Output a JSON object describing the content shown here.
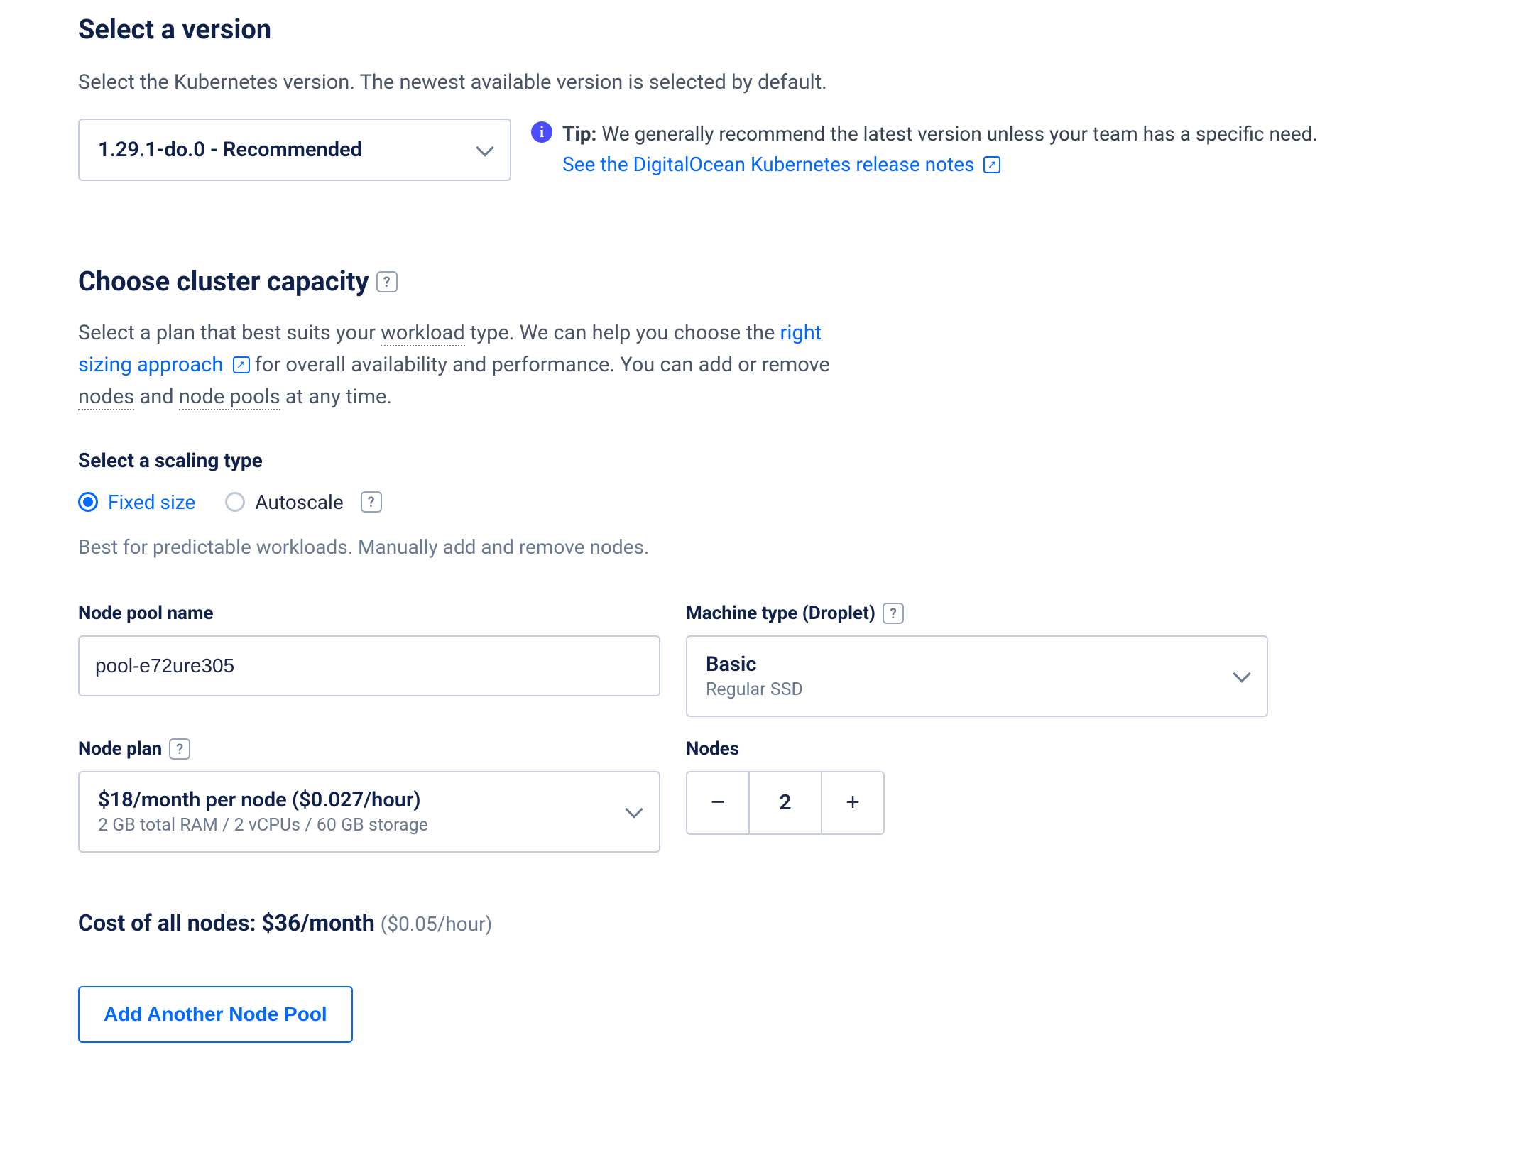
{
  "version": {
    "heading": "Select a version",
    "description": "Select the Kubernetes version. The newest available version is selected by default.",
    "selected": "1.29.1-do.0 - Recommended",
    "tip_label": "Tip:",
    "tip_text": "We generally recommend the latest version unless your team has a specific need.",
    "tip_link": "See the DigitalOcean Kubernetes release notes"
  },
  "capacity": {
    "heading": "Choose cluster capacity",
    "desc_pre": "Select a plan that best suits your ",
    "desc_workload": "workload",
    "desc_mid": " type. We can help you choose the ",
    "link_sizing": "right sizing approach",
    "desc_after_link": " for overall availability and performance. You can add or remove ",
    "desc_nodes": "nodes",
    "desc_and": " and ",
    "desc_nodepools": "node pools",
    "desc_end": " at any time.",
    "scaling_label": "Select a scaling type",
    "scaling_options": {
      "fixed": "Fixed size",
      "autoscale": "Autoscale"
    },
    "scaling_note": "Best for predictable workloads. Manually add and remove nodes.",
    "nodepool": {
      "name_label": "Node pool name",
      "name_value": "pool-e72ure305",
      "machine_label": "Machine type (Droplet)",
      "machine_value": "Basic",
      "machine_sub": "Regular SSD",
      "plan_label": "Node plan",
      "plan_value": "$18/month per node ($0.027/hour)",
      "plan_sub": "2 GB total RAM / 2 vCPUs / 60 GB storage",
      "nodes_label": "Nodes",
      "nodes_count": "2"
    },
    "cost_prefix": "Cost of all nodes: ",
    "cost_main": "$36/month",
    "cost_secondary": "($0.05/hour)",
    "add_pool_button": "Add Another Node Pool"
  }
}
